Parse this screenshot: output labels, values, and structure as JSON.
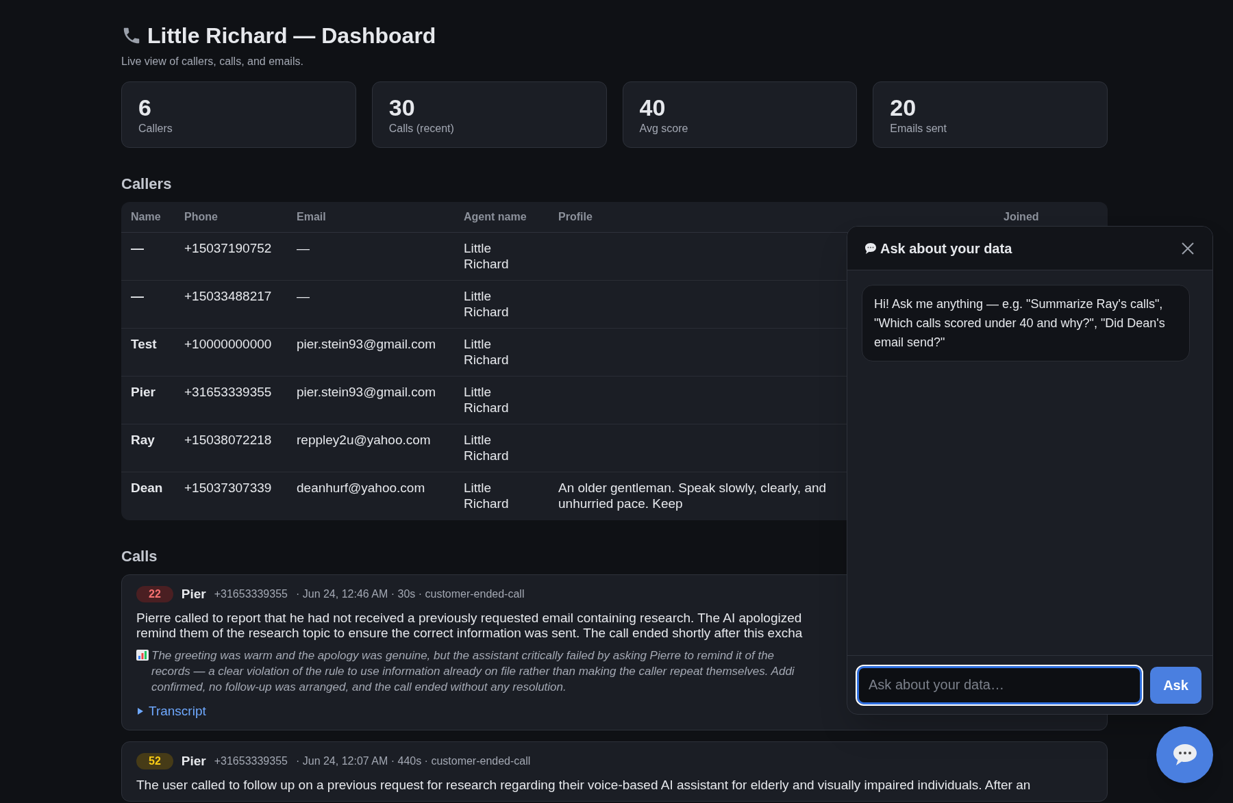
{
  "header": {
    "title": "Little Richard — Dashboard",
    "subtitle": "Live view of callers, calls, and emails."
  },
  "stats": [
    {
      "value": "6",
      "label": "Callers"
    },
    {
      "value": "30",
      "label": "Calls (recent)"
    },
    {
      "value": "40",
      "label": "Avg score"
    },
    {
      "value": "20",
      "label": "Emails sent"
    }
  ],
  "callers": {
    "heading": "Callers",
    "columns": [
      "Name",
      "Phone",
      "Email",
      "Agent name",
      "Profile",
      "Joined"
    ],
    "rows": [
      {
        "name": "—",
        "phone": "+15037190752",
        "email": "—",
        "agent_name": [
          "Little",
          "Richard"
        ],
        "profile": []
      },
      {
        "name": "—",
        "phone": "+15033488217",
        "email": "—",
        "agent_name": [
          "Little",
          "Richard"
        ],
        "profile": []
      },
      {
        "name": "Test",
        "phone": "+10000000000",
        "email": "pier.stein93@gmail.com",
        "agent_name": [
          "Little",
          "Richard"
        ],
        "profile": []
      },
      {
        "name": "Pier",
        "phone": "+31653339355",
        "email": "pier.stein93@gmail.com",
        "agent_name": [
          "Little",
          "Richard"
        ],
        "profile": []
      },
      {
        "name": "Ray",
        "phone": "+15038072218",
        "email": "reppley2u@yahoo.com",
        "agent_name": [
          "Little",
          "Richard"
        ],
        "profile": []
      },
      {
        "name": "Dean",
        "phone": "+15037307339",
        "email": "deanhurf@yahoo.com",
        "agent_name": [
          "Little",
          "Richard"
        ],
        "profile": [
          "An older gentleman. Speak slowly, clearly, and",
          "unhurried pace. Keep"
        ]
      }
    ]
  },
  "calls": {
    "heading": "Calls",
    "items": [
      {
        "score": "22",
        "kind": "low",
        "name": "Pier",
        "phone": "+31653339355",
        "meta": "· Jun 24, 12:46 AM · 30s · customer-ended-call",
        "summary": [
          "Pierre called to report that he had not received a previously requested email containing research. The AI apologized",
          "remind them of the research topic to ensure the correct information was sent. The call ended shortly after this excha"
        ],
        "feedback": [
          "The greeting was warm and the apology was genuine, but the assistant critically failed by asking Pierre to remind it of the",
          "records — a clear violation of the rule to use information already on file rather than making the caller repeat themselves. Addi",
          "confirmed, no follow-up was arranged, and the call ended without any resolution."
        ],
        "transcript": {
          "label": "Transcript",
          "expanded": false
        }
      },
      {
        "score": "52",
        "kind": "medium",
        "name": "Pier",
        "phone": "+31653339355",
        "meta": "· Jun 24, 12:07 AM · 440s · customer-ended-call",
        "summary": [
          "The user called to follow up on a previous request for research regarding their voice-based AI assistant for elderly and visually impaired individuals. After an"
        ]
      }
    ]
  },
  "chat": {
    "title": "Ask about your data",
    "messages": [
      {
        "text": "Hi! Ask me anything — e.g. \"Summarize Ray's calls\", \"Which calls scored under 40 and why?\", \"Did Dean's email send?\""
      }
    ],
    "input": {
      "placeholder": "Ask about your data…"
    },
    "send_button": "Ask"
  }
}
